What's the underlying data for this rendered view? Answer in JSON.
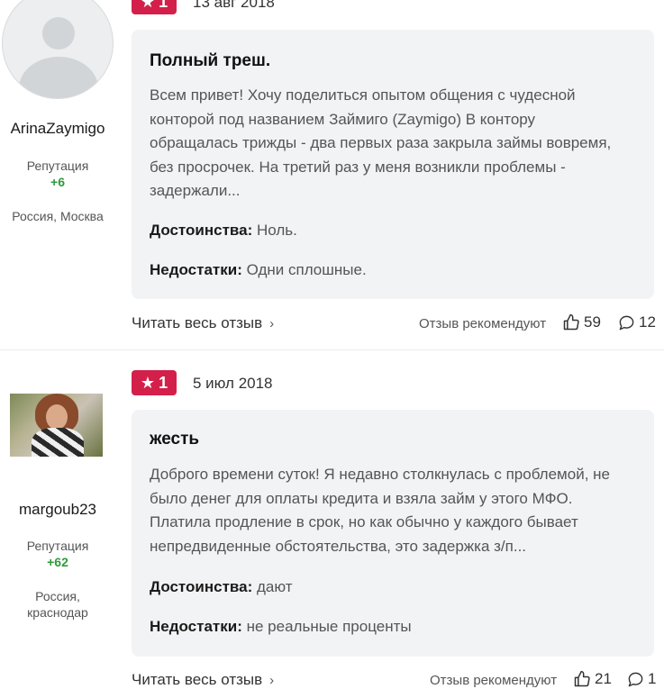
{
  "reviews": [
    {
      "author": {
        "name": "ArinaZaymigo",
        "reputation_label": "Репутация",
        "reputation_value": "+6",
        "location": "Россия, Москва",
        "avatar": "default-avatar-icon"
      },
      "rating": "1",
      "date": "13 авг 2018",
      "title": "Полный треш.",
      "text": "Всем привет! Хочу поделиться опытом общения с чудесной конторой под названием Займиго (Zaymigo) В контору обращалась трижды - два первых раза закрыла займы вовремя, без просрочек. На третий раз у меня возникли проблемы - задержали...",
      "pros_label": "Достоинства:",
      "pros": "Ноль.",
      "cons_label": "Недостатки:",
      "cons": "Одни сплошные.",
      "read_more": "Читать весь отзыв",
      "recommend_label": "Отзыв рекомендуют",
      "likes": "59",
      "comments": "12"
    },
    {
      "author": {
        "name": "margoub23",
        "reputation_label": "Репутация",
        "reputation_value": "+62",
        "location_line1": "Россия,",
        "location_line2": "краснодар",
        "avatar": "user-photo"
      },
      "rating": "1",
      "date": "5 июл 2018",
      "title": "жесть",
      "text": "Доброго времени суток! Я недавно столкнулась с проблемой, не было денег для оплаты кредита и взяла займ у этого МФО. Платила продление в срок, но как обычно у каждого бывает непредвиденные обстоятельства, это задержка з/п...",
      "pros_label": "Достоинства:",
      "pros": "дают",
      "cons_label": "Недостатки:",
      "cons": "не реальные проценты",
      "read_more": "Читать весь отзыв",
      "recommend_label": "Отзыв рекомендуют",
      "likes": "21",
      "comments": "1"
    }
  ],
  "colors": {
    "badge": "#d3204a",
    "reputation": "#2e9b3a",
    "card_bg": "#f2f3f5"
  },
  "icons": {
    "rating": "star-icon",
    "read_more": "chevron-right-icon",
    "likes": "thumbs-up-icon",
    "comments": "comment-bubble-icon"
  }
}
